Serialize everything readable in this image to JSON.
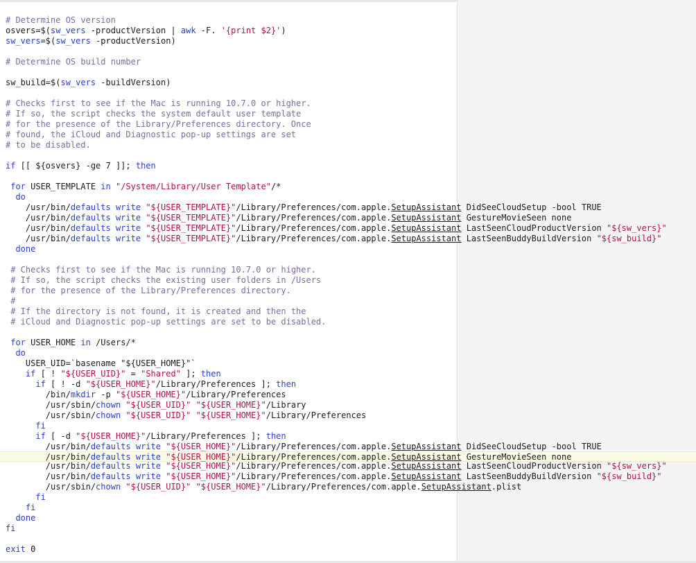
{
  "editor": {
    "current_line_index": 42,
    "colors": {
      "comment": "#7e6aa0",
      "keyword": "#2a3ec8",
      "string": "#b0104a",
      "plain": "#1a1a1a",
      "current_line_bg": "#fcfce6",
      "gutter_bg": "#f4f4f4"
    },
    "lines": [
      [
        [
          "c",
          "# Determine OS version"
        ]
      ],
      [
        [
          "p",
          "osvers=$("
        ],
        [
          "k",
          "sw_vers"
        ],
        [
          "p",
          " -productVersion | "
        ],
        [
          "k",
          "awk"
        ],
        [
          "p",
          " -F. "
        ],
        [
          "s",
          "'{print $2}'"
        ],
        [
          "p",
          ")"
        ]
      ],
      [
        [
          "k",
          "sw_vers"
        ],
        [
          "p",
          "=$("
        ],
        [
          "k",
          "sw_vers"
        ],
        [
          "p",
          " -productVersion)"
        ]
      ],
      [],
      [
        [
          "c",
          "# Determine OS build number"
        ]
      ],
      [],
      [
        [
          "p",
          "sw_build=$("
        ],
        [
          "k",
          "sw_vers"
        ],
        [
          "p",
          " -buildVersion)"
        ]
      ],
      [],
      [
        [
          "c",
          "# Checks first to see if the Mac is running 10.7.0 or higher."
        ]
      ],
      [
        [
          "c",
          "# If so, the script checks the system default user template"
        ]
      ],
      [
        [
          "c",
          "# for the presence of the Library/Preferences directory. Once"
        ]
      ],
      [
        [
          "c",
          "# found, the iCloud and Diagnostic pop-up settings are set"
        ]
      ],
      [
        [
          "c",
          "# to be disabled."
        ]
      ],
      [],
      [
        [
          "k",
          "if"
        ],
        [
          "p",
          " [[ ${osvers} -ge 7 ]]; "
        ],
        [
          "k",
          "then"
        ]
      ],
      [],
      [
        [
          "p",
          " "
        ],
        [
          "k",
          "for"
        ],
        [
          "p",
          " USER_TEMPLATE "
        ],
        [
          "k",
          "in"
        ],
        [
          "p",
          " "
        ],
        [
          "s",
          "\"/System/Library/User Template\""
        ],
        [
          "p",
          "/*"
        ]
      ],
      [
        [
          "p",
          "  "
        ],
        [
          "k",
          "do"
        ]
      ],
      [
        [
          "p",
          "    /usr/bin/"
        ],
        [
          "k",
          "defaults"
        ],
        [
          "p",
          " "
        ],
        [
          "k",
          "write"
        ],
        [
          "p",
          " "
        ],
        [
          "s",
          "\"${USER_TEMPLATE}\""
        ],
        [
          "p",
          "/Library/Preferences/com.apple."
        ],
        [
          "u",
          "SetupAssistant"
        ],
        [
          "p",
          " DidSeeCloudSetup -bool TRUE"
        ]
      ],
      [
        [
          "p",
          "    /usr/bin/"
        ],
        [
          "k",
          "defaults"
        ],
        [
          "p",
          " "
        ],
        [
          "k",
          "write"
        ],
        [
          "p",
          " "
        ],
        [
          "s",
          "\"${USER_TEMPLATE}\""
        ],
        [
          "p",
          "/Library/Preferences/com.apple."
        ],
        [
          "u",
          "SetupAssistant"
        ],
        [
          "p",
          " GestureMovieSeen none"
        ]
      ],
      [
        [
          "p",
          "    /usr/bin/"
        ],
        [
          "k",
          "defaults"
        ],
        [
          "p",
          " "
        ],
        [
          "k",
          "write"
        ],
        [
          "p",
          " "
        ],
        [
          "s",
          "\"${USER_TEMPLATE}\""
        ],
        [
          "p",
          "/Library/Preferences/com.apple."
        ],
        [
          "u",
          "SetupAssistant"
        ],
        [
          "p",
          " LastSeenCloudProductVersion "
        ],
        [
          "s",
          "\"${sw_vers}\""
        ]
      ],
      [
        [
          "p",
          "    /usr/bin/"
        ],
        [
          "k",
          "defaults"
        ],
        [
          "p",
          " "
        ],
        [
          "k",
          "write"
        ],
        [
          "p",
          " "
        ],
        [
          "s",
          "\"${USER_TEMPLATE}\""
        ],
        [
          "p",
          "/Library/Preferences/com.apple."
        ],
        [
          "u",
          "SetupAssistant"
        ],
        [
          "p",
          " LastSeenBuddyBuildVersion "
        ],
        [
          "s",
          "\"${sw_build}\""
        ]
      ],
      [
        [
          "p",
          "  "
        ],
        [
          "k",
          "done"
        ]
      ],
      [],
      [
        [
          "p",
          " "
        ],
        [
          "c",
          "# Checks first to see if the Mac is running 10.7.0 or higher."
        ]
      ],
      [
        [
          "p",
          " "
        ],
        [
          "c",
          "# If so, the script checks the existing user folders in /Users"
        ]
      ],
      [
        [
          "p",
          " "
        ],
        [
          "c",
          "# for the presence of the Library/Preferences directory."
        ]
      ],
      [
        [
          "p",
          " "
        ],
        [
          "c",
          "#"
        ]
      ],
      [
        [
          "p",
          " "
        ],
        [
          "c",
          "# If the directory is not found, it is created and then the"
        ]
      ],
      [
        [
          "p",
          " "
        ],
        [
          "c",
          "# iCloud and Diagnostic pop-up settings are set to be disabled."
        ]
      ],
      [],
      [
        [
          "p",
          " "
        ],
        [
          "k",
          "for"
        ],
        [
          "p",
          " USER_HOME "
        ],
        [
          "k",
          "in"
        ],
        [
          "p",
          " /Users/*"
        ]
      ],
      [
        [
          "p",
          "  "
        ],
        [
          "k",
          "do"
        ]
      ],
      [
        [
          "p",
          "    USER_UID=`basename \"${USER_HOME}\"`"
        ]
      ],
      [
        [
          "p",
          "    "
        ],
        [
          "k",
          "if"
        ],
        [
          "p",
          " [ ! "
        ],
        [
          "s",
          "\"${USER_UID}\""
        ],
        [
          "p",
          " = "
        ],
        [
          "s",
          "\"Shared\""
        ],
        [
          "p",
          " ]; "
        ],
        [
          "k",
          "then"
        ]
      ],
      [
        [
          "p",
          "      "
        ],
        [
          "k",
          "if"
        ],
        [
          "p",
          " [ ! -d "
        ],
        [
          "s",
          "\"${USER_HOME}\""
        ],
        [
          "p",
          "/Library/Preferences ]; "
        ],
        [
          "k",
          "then"
        ]
      ],
      [
        [
          "p",
          "        /bin/"
        ],
        [
          "k",
          "mkdir"
        ],
        [
          "p",
          " -p "
        ],
        [
          "s",
          "\"${USER_HOME}\""
        ],
        [
          "p",
          "/Library/Preferences"
        ]
      ],
      [
        [
          "p",
          "        /usr/sbin/"
        ],
        [
          "k",
          "chown"
        ],
        [
          "p",
          " "
        ],
        [
          "s",
          "\"${USER_UID}\""
        ],
        [
          "p",
          " "
        ],
        [
          "s",
          "\"${USER_HOME}\""
        ],
        [
          "p",
          "/Library"
        ]
      ],
      [
        [
          "p",
          "        /usr/sbin/"
        ],
        [
          "k",
          "chown"
        ],
        [
          "p",
          " "
        ],
        [
          "s",
          "\"${USER_UID}\""
        ],
        [
          "p",
          " "
        ],
        [
          "s",
          "\"${USER_HOME}\""
        ],
        [
          "p",
          "/Library/Preferences"
        ]
      ],
      [
        [
          "p",
          "      "
        ],
        [
          "k",
          "fi"
        ]
      ],
      [
        [
          "p",
          "      "
        ],
        [
          "k",
          "if"
        ],
        [
          "p",
          " [ -d "
        ],
        [
          "s",
          "\"${USER_HOME}\""
        ],
        [
          "p",
          "/Library/Preferences ]; "
        ],
        [
          "k",
          "then"
        ]
      ],
      [
        [
          "p",
          "        /usr/bin/"
        ],
        [
          "k",
          "defaults"
        ],
        [
          "p",
          " "
        ],
        [
          "k",
          "write"
        ],
        [
          "p",
          " "
        ],
        [
          "s",
          "\"${USER_HOME}\""
        ],
        [
          "p",
          "/Library/Preferences/com.apple."
        ],
        [
          "u",
          "SetupAssistant"
        ],
        [
          "p",
          " DidSeeCloudSetup -bool TRUE"
        ]
      ],
      [
        [
          "p",
          "        /usr/bin/"
        ],
        [
          "k",
          "defaults"
        ],
        [
          "p",
          " "
        ],
        [
          "k",
          "write"
        ],
        [
          "p",
          " "
        ],
        [
          "s",
          "\"${USER_HOME}\""
        ],
        [
          "p",
          "/Library/Preferences/com.apple."
        ],
        [
          "u",
          "SetupAssistant"
        ],
        [
          "p",
          " GestureMovieSeen none"
        ]
      ],
      [
        [
          "p",
          "        /usr/bin/"
        ],
        [
          "k",
          "defaults"
        ],
        [
          "p",
          " "
        ],
        [
          "k",
          "write"
        ],
        [
          "p",
          " "
        ],
        [
          "s",
          "\"${USER_HOME}\""
        ],
        [
          "p",
          "/Library/Preferences/com.apple."
        ],
        [
          "u",
          "SetupAssistant"
        ],
        [
          "p",
          " LastSeenCloudProductVersion "
        ],
        [
          "s",
          "\"${sw_vers}\""
        ]
      ],
      [
        [
          "p",
          "        /usr/bin/"
        ],
        [
          "k",
          "defaults"
        ],
        [
          "p",
          " "
        ],
        [
          "k",
          "write"
        ],
        [
          "p",
          " "
        ],
        [
          "s",
          "\"${USER_HOME}\""
        ],
        [
          "p",
          "/Library/Preferences/com.apple."
        ],
        [
          "u",
          "SetupAssistant"
        ],
        [
          "p",
          " LastSeenBuddyBuildVersion "
        ],
        [
          "s",
          "\"${sw_build}\""
        ]
      ],
      [
        [
          "p",
          "        /usr/sbin/"
        ],
        [
          "k",
          "chown"
        ],
        [
          "p",
          " "
        ],
        [
          "s",
          "\"${USER_UID}\""
        ],
        [
          "p",
          " "
        ],
        [
          "s",
          "\"${USER_HOME}\""
        ],
        [
          "p",
          "/Library/Preferences/com.apple."
        ],
        [
          "u",
          "SetupAssistant"
        ],
        [
          "p",
          ".plist"
        ]
      ],
      [
        [
          "p",
          "      "
        ],
        [
          "k",
          "fi"
        ]
      ],
      [
        [
          "p",
          "    "
        ],
        [
          "k",
          "fi"
        ]
      ],
      [
        [
          "p",
          "  "
        ],
        [
          "k",
          "done"
        ]
      ],
      [
        [
          "k",
          "fi"
        ]
      ],
      [],
      [
        [
          "k",
          "exit"
        ],
        [
          "p",
          " 0"
        ]
      ]
    ]
  }
}
